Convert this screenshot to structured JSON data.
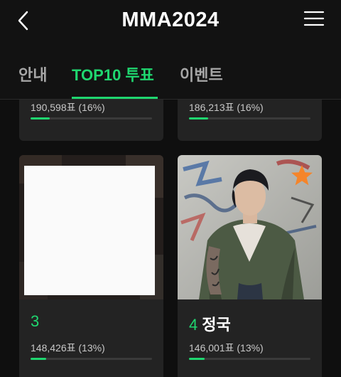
{
  "header": {
    "title": "MMA2024"
  },
  "tabs": [
    {
      "label": "안내"
    },
    {
      "label": "TOP10 투표"
    },
    {
      "label": "이벤트"
    }
  ],
  "active_tab": "TOP10 투표",
  "candidates": [
    {
      "rank": "",
      "name": "",
      "votes": "190,598표 (16%)",
      "percent": 16
    },
    {
      "rank": "",
      "name": "",
      "votes": "186,213표 (16%)",
      "percent": 16
    },
    {
      "rank": "3",
      "name": "",
      "votes": "148,426표 (13%)",
      "percent": 13
    },
    {
      "rank": "4",
      "name": "정국",
      "votes": "146,001표 (13%)",
      "percent": 13
    }
  ],
  "colors": {
    "accent": "#1fd66f",
    "background": "#0f0f0f",
    "card": "#232323",
    "star": "#f5852a"
  },
  "icons": {
    "back": "chevron-left-icon",
    "menu": "hamburger-menu-icon",
    "favorite": "star-icon"
  }
}
